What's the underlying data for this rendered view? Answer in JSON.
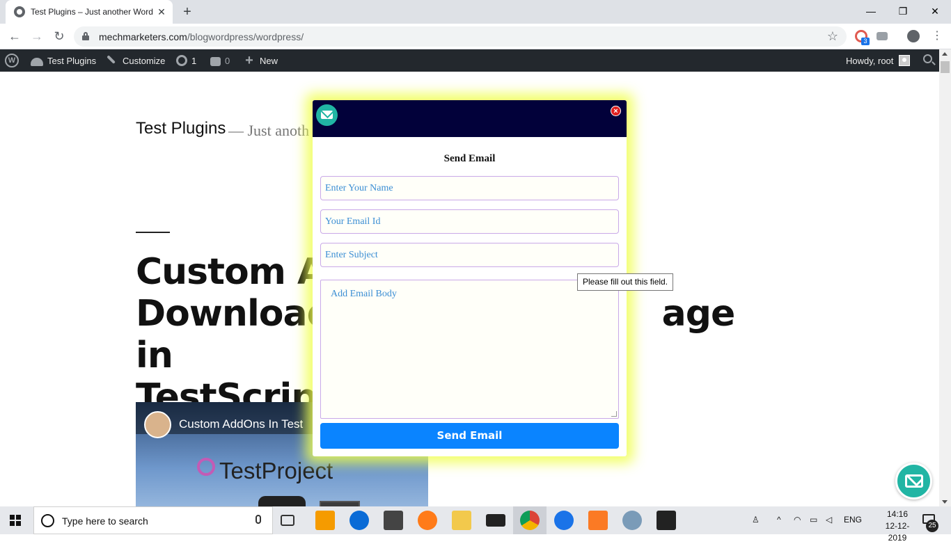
{
  "browser": {
    "tab_title": "Test Plugins – Just another Word",
    "url_host": "mechmarketers.com",
    "url_path": "/blogwordpress/wordpress/",
    "extension_badge": "3"
  },
  "admin_bar": {
    "site_name": "Test Plugins",
    "customize": "Customize",
    "updates_count": "1",
    "comments_count": "0",
    "new_label": "New",
    "greeting": "Howdy, root"
  },
  "page": {
    "site_title": "Test Plugins",
    "site_description": "— Just anoth",
    "post_title": "Custom Add                                Downloadi                                  age in TestScripts",
    "video_title": "Custom AddOns In Test",
    "video_brand": "TestProject"
  },
  "modal": {
    "title": "Send Email",
    "name_placeholder": "Enter Your Name",
    "email_placeholder": "Your Email Id",
    "subject_placeholder": "Enter Subject",
    "body_placeholder": "Add Email Body",
    "submit_label": "Send Email"
  },
  "tooltip": "Please fill out this field.",
  "taskbar": {
    "search_placeholder": "Type here to search",
    "lang": "ENG",
    "time": "14:16",
    "date": "12-12-2019",
    "notifications": "25"
  },
  "colors": {
    "modal_header": "#02013a",
    "accent_teal": "#21b5a4",
    "send_button": "#0a84ff",
    "glow": "#f0ff50"
  }
}
